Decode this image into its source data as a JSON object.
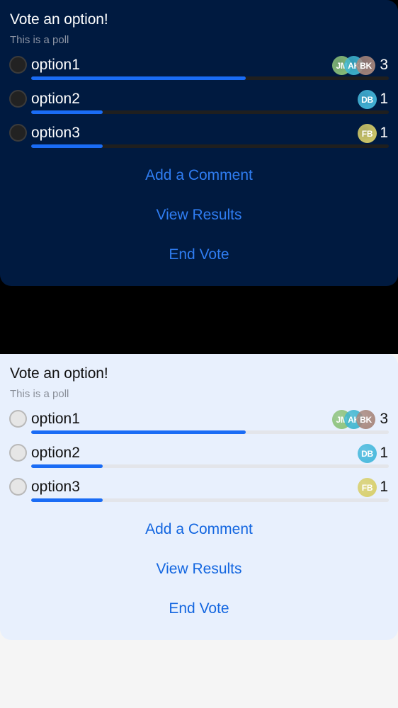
{
  "polls": [
    {
      "theme": "dark",
      "title": "Vote an option!",
      "subtitle": "This is a poll",
      "options": [
        {
          "label": "option1",
          "count": "3",
          "fraction": 0.6,
          "voters": [
            "JM",
            "AK",
            "BK"
          ]
        },
        {
          "label": "option2",
          "count": "1",
          "fraction": 0.2,
          "voters": [
            "DB"
          ]
        },
        {
          "label": "option3",
          "count": "1",
          "fraction": 0.2,
          "voters": [
            "FB"
          ]
        }
      ],
      "actions": {
        "comment": "Add a Comment",
        "results": "View Results",
        "end": "End Vote"
      }
    },
    {
      "theme": "light",
      "title": "Vote an option!",
      "subtitle": "This is a poll",
      "options": [
        {
          "label": "option1",
          "count": "3",
          "fraction": 0.6,
          "voters": [
            "JM",
            "AK",
            "BK"
          ]
        },
        {
          "label": "option2",
          "count": "1",
          "fraction": 0.2,
          "voters": [
            "DB"
          ]
        },
        {
          "label": "option3",
          "count": "1",
          "fraction": 0.2,
          "voters": [
            "FB"
          ]
        }
      ],
      "actions": {
        "comment": "Add a Comment",
        "results": "View Results",
        "end": "End Vote"
      }
    }
  ],
  "avatar_colors": {
    "JM": "#8cc27a",
    "AK": "#3fb6d0",
    "BK": "#a8877c",
    "DB": "#45b8dc",
    "FB": "#d8cf6a"
  },
  "colors": {
    "accent": "#1a6cf5"
  }
}
